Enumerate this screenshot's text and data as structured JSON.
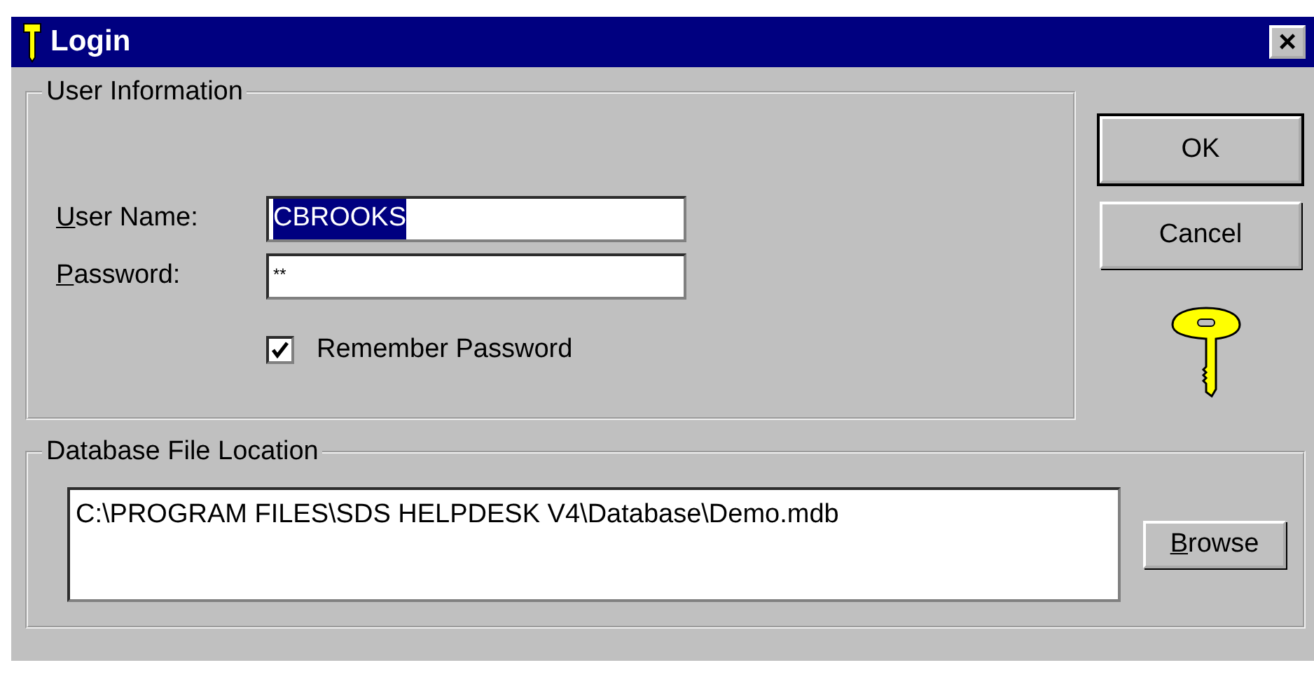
{
  "window": {
    "title": "Login",
    "close": "×"
  },
  "user_information": {
    "legend": "User Information",
    "fields": [
      {
        "label": "User Name:",
        "mnemonic": true,
        "value": "CBROOKS",
        "selected": true,
        "kind": "text"
      },
      {
        "label": "Password:",
        "mnemonic": true,
        "value": "**",
        "selected": false,
        "kind": "password"
      }
    ],
    "remember": {
      "label": "Remember Password",
      "checked": true
    }
  },
  "buttons": [
    {
      "label": "OK",
      "default": true
    },
    {
      "label": "Cancel",
      "default": false
    }
  ],
  "database": {
    "legend": "Database File Location",
    "path": "C:\\PROGRAM FILES\\SDS HELPDESK V4\\Database\\Demo.mdb",
    "browse": {
      "label": "Browse",
      "mnemonic": true
    }
  }
}
